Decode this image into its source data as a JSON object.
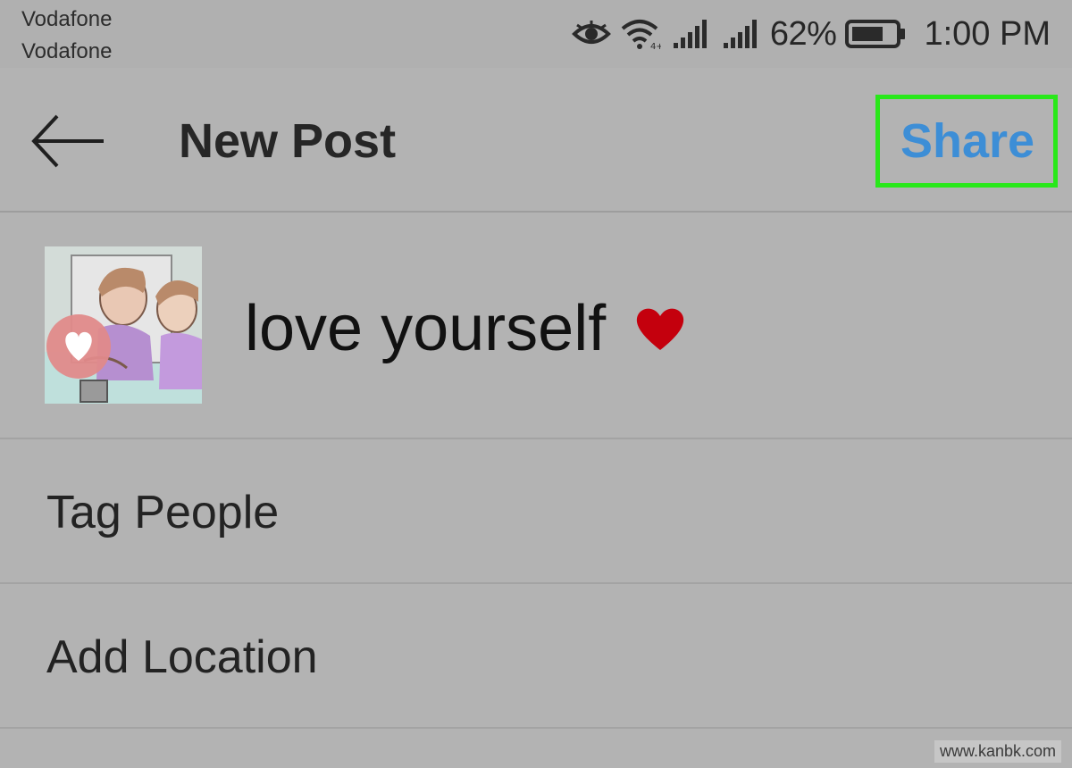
{
  "status_bar": {
    "carrier_1": "Vodafone",
    "carrier_2": "Vodafone",
    "battery_percent": "62%",
    "time": "1:00 PM",
    "icons": [
      "eye-icon",
      "wifi-icon",
      "signal-icon",
      "signal-icon",
      "battery-icon"
    ]
  },
  "header": {
    "title": "New Post",
    "share_label": "Share",
    "back_icon": "arrow-left-icon",
    "colors": {
      "share": "#3d8ed6",
      "highlight": "#29e81a"
    }
  },
  "post": {
    "caption": "love yourself",
    "emoji_icon": "red-heart-icon",
    "thumbnail_icon": "heart-badge-icon"
  },
  "options": {
    "tag_people": "Tag People",
    "add_location": "Add Location"
  },
  "watermark": "www.kanbk.com"
}
